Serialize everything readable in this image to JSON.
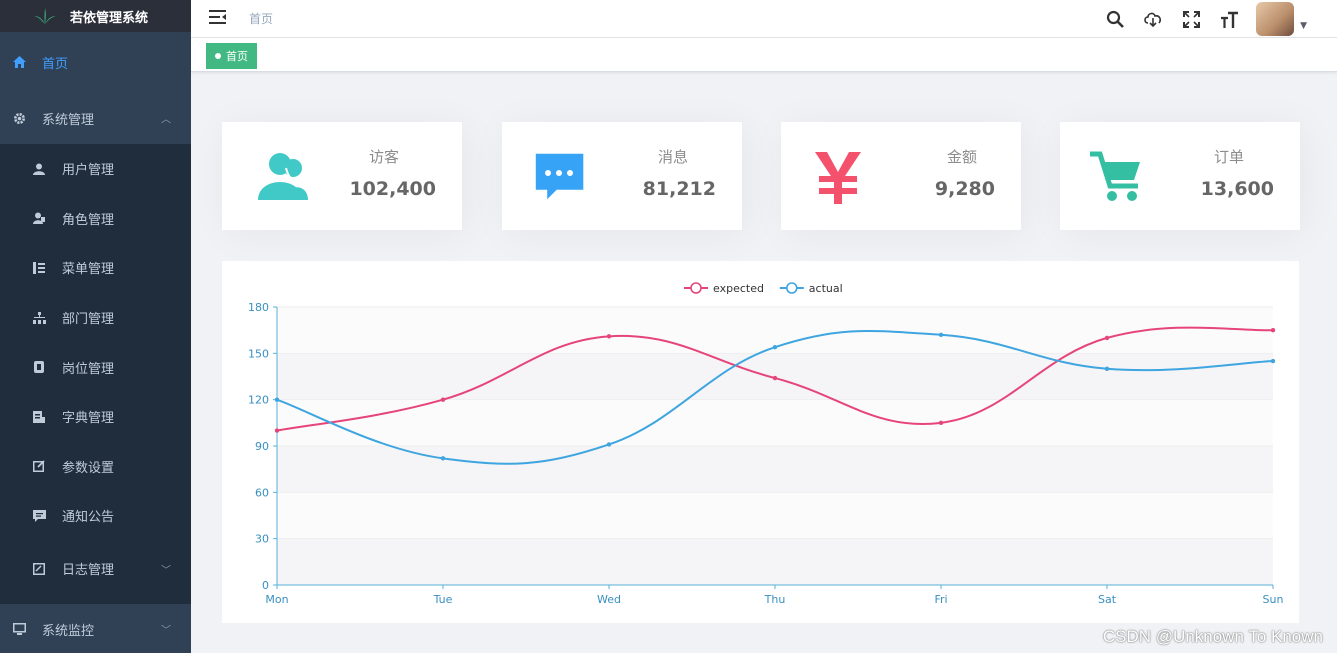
{
  "app": {
    "title": "若依管理系统"
  },
  "navbar": {
    "breadcrumb": "首页",
    "icons": [
      "search-icon",
      "cloud-download-icon",
      "fullscreen-icon",
      "text-size-icon"
    ]
  },
  "tags": [
    {
      "label": "首页",
      "active": true
    }
  ],
  "sidebar": {
    "items": [
      {
        "label": "首页",
        "icon": "home-icon",
        "active": true
      },
      {
        "label": "系统管理",
        "icon": "gear-icon",
        "expanded": true,
        "children": [
          {
            "label": "用户管理",
            "icon": "user-icon"
          },
          {
            "label": "角色管理",
            "icon": "role-icon"
          },
          {
            "label": "菜单管理",
            "icon": "menu-tree-icon"
          },
          {
            "label": "部门管理",
            "icon": "org-tree-icon"
          },
          {
            "label": "岗位管理",
            "icon": "post-icon"
          },
          {
            "label": "字典管理",
            "icon": "dictionary-icon"
          },
          {
            "label": "参数设置",
            "icon": "edit-icon"
          },
          {
            "label": "通知公告",
            "icon": "message-icon"
          },
          {
            "label": "日志管理",
            "icon": "log-icon"
          }
        ]
      },
      {
        "label": "系统监控",
        "icon": "monitor-icon"
      }
    ]
  },
  "cards": [
    {
      "title": "访客",
      "value": "102,400",
      "icon": "visitors-icon",
      "color": "#40c9c6"
    },
    {
      "title": "消息",
      "value": "81,212",
      "icon": "message-bubble-icon",
      "color": "#36a3f7"
    },
    {
      "title": "金额",
      "value": "9,280",
      "icon": "yen-icon",
      "color": "#f4516c"
    },
    {
      "title": "订单",
      "value": "13,600",
      "icon": "shopping-cart-icon",
      "color": "#34bfa3"
    }
  ],
  "chart_data": {
    "type": "line",
    "categories": [
      "Mon",
      "Tue",
      "Wed",
      "Thu",
      "Fri",
      "Sat",
      "Sun"
    ],
    "series": [
      {
        "name": "expected",
        "values": [
          100,
          120,
          161,
          134,
          105,
          160,
          165
        ],
        "color": "#e6457a"
      },
      {
        "name": "actual",
        "values": [
          120,
          82,
          91,
          154,
          162,
          140,
          145
        ],
        "color": "#3ea5e0"
      }
    ],
    "yticks": [
      0,
      30,
      60,
      90,
      120,
      150,
      180
    ],
    "ylim": [
      0,
      180
    ],
    "legend_position": "top-center",
    "grid": true
  },
  "watermark": "CSDN @Unknown To Known"
}
